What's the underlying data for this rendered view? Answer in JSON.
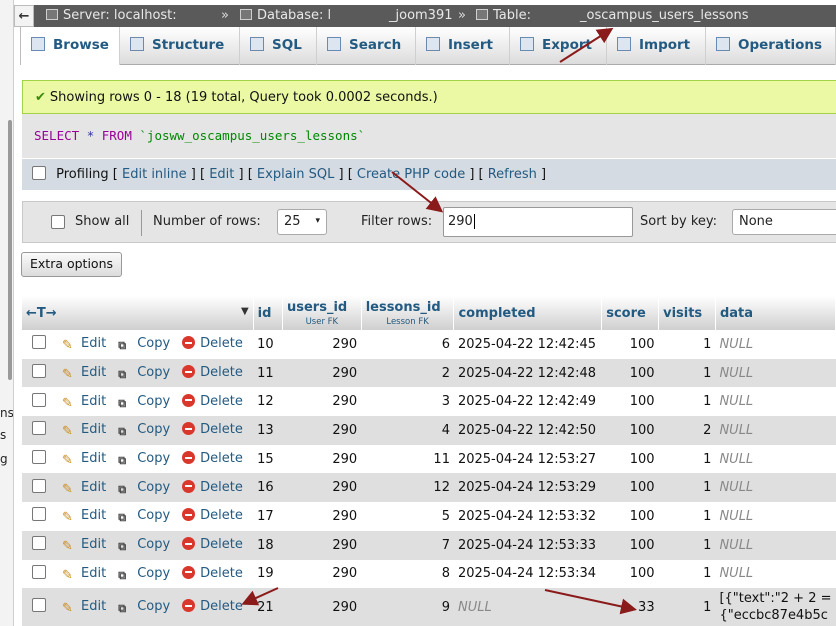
{
  "leftnav": {
    "fragments": [
      "ns",
      "s",
      "g"
    ]
  },
  "breadcrumb": {
    "collapse": "←",
    "server": "Server: localhost:",
    "sep1": "»",
    "database": "Database: l",
    "database_tail": "_joom391",
    "sep2": "»",
    "table": "Table:",
    "table_tail": "_oscampus_users_lessons"
  },
  "tabs": [
    "Browse",
    "Structure",
    "SQL",
    "Search",
    "Insert",
    "Export",
    "Import",
    "Operations"
  ],
  "message": {
    "text": "Showing rows 0 - 18 (19 total, Query took 0.0002 seconds.)"
  },
  "sql": {
    "select": "SELECT",
    "star": "*",
    "from": "FROM",
    "table": "`josww_oscampus_users_lessons`"
  },
  "profiling": {
    "label": "Profiling",
    "links": [
      "Edit inline",
      "Edit",
      "Explain SQL",
      "Create PHP code",
      "Refresh"
    ]
  },
  "navbar": {
    "show_all": "Show all",
    "rows_label": "Number of rows:",
    "rows_value": "25",
    "filter_label": "Filter rows:",
    "filter_value": "290",
    "sort_label": "Sort by key:",
    "sort_value": "None"
  },
  "extra_options": "Extra options",
  "table": {
    "arrows": "←T→",
    "headers": [
      "id",
      "users_id",
      "lessons_id",
      "completed",
      "score",
      "visits",
      "data"
    ],
    "fk": {
      "users_id": "User FK",
      "lessons_id": "Lesson FK"
    },
    "actions": {
      "edit": "Edit",
      "copy": "Copy",
      "delete": "Delete"
    },
    "null": "NULL",
    "rows": [
      {
        "id": "10",
        "users_id": "290",
        "lessons_id": "6",
        "completed": "2025-04-22 12:42:45",
        "score": "100",
        "visits": "1",
        "data": "NULL"
      },
      {
        "id": "11",
        "users_id": "290",
        "lessons_id": "2",
        "completed": "2025-04-22 12:42:48",
        "score": "100",
        "visits": "1",
        "data": "NULL"
      },
      {
        "id": "12",
        "users_id": "290",
        "lessons_id": "3",
        "completed": "2025-04-22 12:42:49",
        "score": "100",
        "visits": "1",
        "data": "NULL"
      },
      {
        "id": "13",
        "users_id": "290",
        "lessons_id": "4",
        "completed": "2025-04-22 12:42:50",
        "score": "100",
        "visits": "2",
        "data": "NULL"
      },
      {
        "id": "15",
        "users_id": "290",
        "lessons_id": "11",
        "completed": "2025-04-24 12:53:27",
        "score": "100",
        "visits": "1",
        "data": "NULL"
      },
      {
        "id": "16",
        "users_id": "290",
        "lessons_id": "12",
        "completed": "2025-04-24 12:53:29",
        "score": "100",
        "visits": "1",
        "data": "NULL"
      },
      {
        "id": "17",
        "users_id": "290",
        "lessons_id": "5",
        "completed": "2025-04-24 12:53:32",
        "score": "100",
        "visits": "1",
        "data": "NULL"
      },
      {
        "id": "18",
        "users_id": "290",
        "lessons_id": "7",
        "completed": "2025-04-24 12:53:33",
        "score": "100",
        "visits": "1",
        "data": "NULL"
      },
      {
        "id": "19",
        "users_id": "290",
        "lessons_id": "8",
        "completed": "2025-04-24 12:53:34",
        "score": "100",
        "visits": "1",
        "data": "NULL"
      },
      {
        "id": "21",
        "users_id": "290",
        "lessons_id": "9",
        "completed": "NULL",
        "score": "33",
        "visits": "1",
        "data": "[{\"text\":\"2 + 2 =",
        "data_line2": "{\"eccbc87e4b5c"
      }
    ]
  },
  "colors": {
    "link": "#235a81",
    "success_bg": "#ebf8a4",
    "annotation_arrow": "#8b1a1a"
  }
}
